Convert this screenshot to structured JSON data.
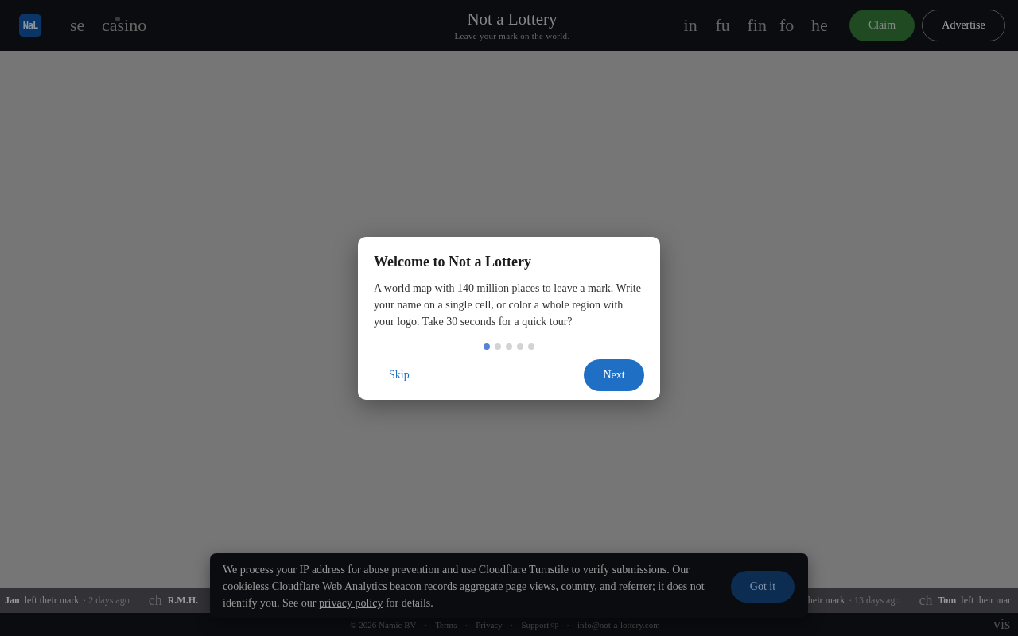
{
  "header": {
    "logo": "NaL",
    "nav_left": [
      {
        "label": "se",
        "dot": false
      },
      {
        "label": "casino",
        "dot": true
      }
    ],
    "title": "Not a Lottery",
    "tagline": "Leave your mark on the world.",
    "icon_links": [
      "in",
      "fu",
      "fin",
      "fo",
      "he"
    ],
    "buttons": [
      {
        "label": "Claim",
        "kind": "primary"
      },
      {
        "label": "Advertise",
        "kind": "outline"
      }
    ]
  },
  "dialog": {
    "title": "Welcome to Not a Lottery",
    "body": "A world map with 140 million places to leave a mark. Write your name on a single cell, or color a whole region with your logo. Take 30 seconds for a quick tour?",
    "steps": [
      {
        "selected": true
      },
      {
        "selected": false
      },
      {
        "selected": false
      },
      {
        "selected": false
      },
      {
        "selected": false
      }
    ],
    "skip": "Skip",
    "next": "Next"
  },
  "ticker": {
    "left": [
      {
        "kind": "entry",
        "name": "Jan",
        "action": "left their mark",
        "time": "· 2 days ago"
      },
      {
        "kind": "glyph",
        "text": "ch"
      },
      {
        "kind": "entry",
        "name": "R.M.H."
      }
    ],
    "right": [
      {
        "kind": "entry",
        "action": "heir mark",
        "time": "· 13 days ago"
      },
      {
        "kind": "glyph",
        "text": "ch"
      },
      {
        "kind": "entry",
        "name": "Tom",
        "action": "left their mar"
      }
    ]
  },
  "cookie_banner": {
    "text_before": "We process your IP address for abuse prevention and use Cloudflare Turnstile to verify submissions. Our cookieless Cloudflare Web Analytics beacon records aggregate page views, country, and referrer; it does not identify you. See our",
    "link": "privacy policy",
    "text_after": "for details.",
    "button": "Got it"
  },
  "footer": {
    "items": [
      {
        "kind": "text",
        "label": "© 2026 Namic BV"
      },
      {
        "kind": "sep",
        "label": "·"
      },
      {
        "kind": "link",
        "label": "Terms"
      },
      {
        "kind": "sep",
        "label": "·"
      },
      {
        "kind": "link",
        "label": "Privacy"
      },
      {
        "kind": "sep",
        "label": "·"
      },
      {
        "kind": "link",
        "label": "Support"
      },
      {
        "kind": "glyph",
        "label": "op"
      },
      {
        "kind": "sep",
        "label": "·"
      },
      {
        "kind": "link",
        "label": "info@not-a-lottery.com"
      }
    ],
    "corner": "vis"
  }
}
